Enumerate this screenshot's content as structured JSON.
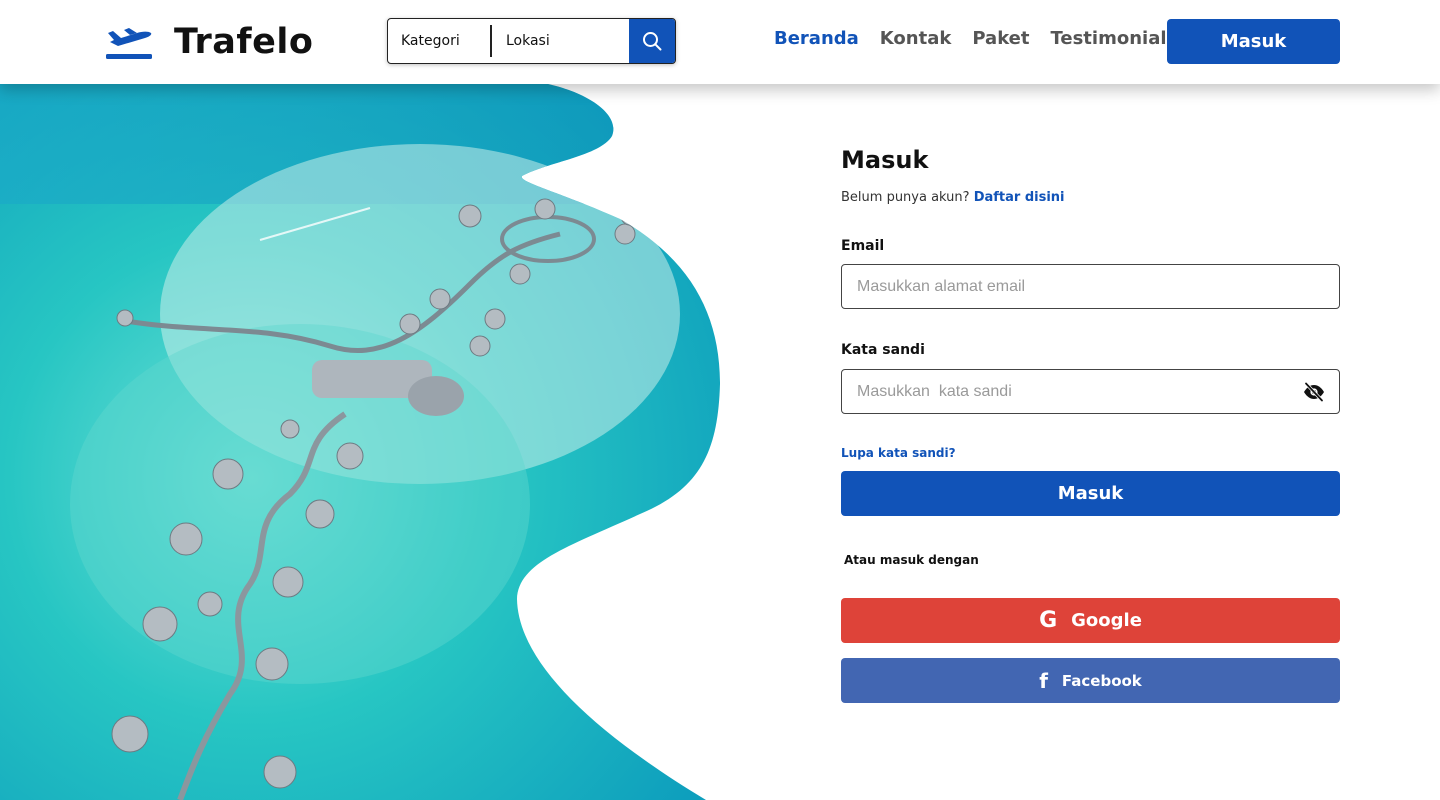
{
  "brand": {
    "name": "Trafelo",
    "primary_color": "#1153b8"
  },
  "search": {
    "category": "Kategori",
    "location": "Lokasi",
    "button_icon": "search-icon"
  },
  "nav": {
    "items": [
      {
        "label": "Beranda",
        "active": true
      },
      {
        "label": "Kontak",
        "active": false
      },
      {
        "label": "Paket",
        "active": false
      },
      {
        "label": "Testimonial",
        "active": false
      }
    ],
    "login_label": "Masuk"
  },
  "hero": {
    "image": "aerial-maldives-overwater-villas"
  },
  "form": {
    "title": "Masuk",
    "register_prompt": "Belum punya akun?",
    "register_link": "Daftar disini",
    "email_label": "Email",
    "email_placeholder": "Masukkan alamat email",
    "password_label": "Kata sandi",
    "password_placeholder": "Masukkan  kata sandi",
    "password_toggle_icon": "eye-off-icon",
    "forgot_label": "Lupa kata sandi?",
    "submit_label": "Masuk",
    "alt_label": "Atau masuk dengan",
    "google_label": "Google",
    "google_color": "#de4339",
    "facebook_label": "Facebook",
    "facebook_color": "#4266b2"
  }
}
